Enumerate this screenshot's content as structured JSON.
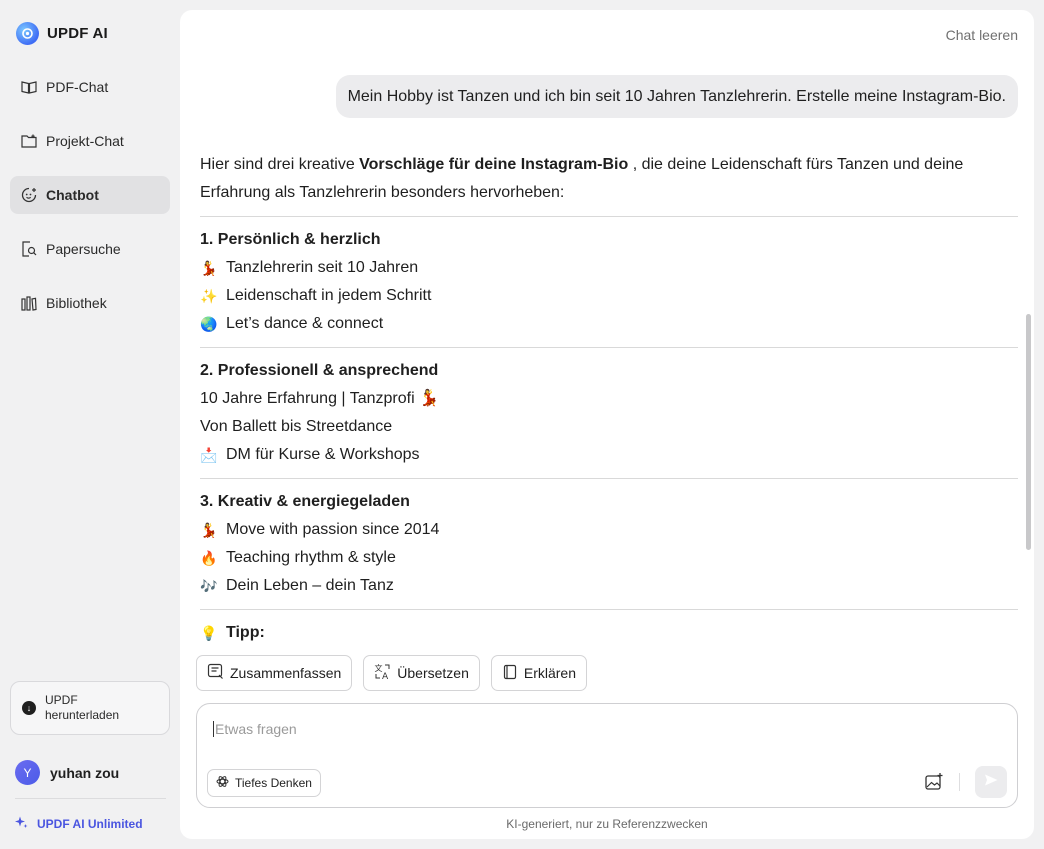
{
  "app": {
    "title": "UPDF AI"
  },
  "sidebar": {
    "items": [
      {
        "label": "PDF-Chat",
        "icon": "book-open-icon",
        "active": false
      },
      {
        "label": "Projekt-Chat",
        "icon": "folder-plus-icon",
        "active": false
      },
      {
        "label": "Chatbot",
        "icon": "chatbot-icon",
        "active": true
      },
      {
        "label": "Papersuche",
        "icon": "paper-search-icon",
        "active": false
      },
      {
        "label": "Bibliothek",
        "icon": "library-icon",
        "active": false
      }
    ],
    "download_label": "UPDF herunterladen",
    "user": {
      "initial": "Y",
      "name": "yuhan zou"
    },
    "unlimited_label": "UPDF AI Unlimited"
  },
  "chat": {
    "clear_label": "Chat leeren",
    "user_message": "Mein Hobby ist Tanzen und ich bin seit 10 Jahren Tanzlehrerin. Erstelle meine Instagram-Bio.",
    "answer": {
      "intro_prefix": "Hier sind drei kreative ",
      "intro_bold": "Vorschläge für deine Instagram-Bio",
      "intro_suffix": " , die deine Leidenschaft fürs Tanzen und deine Erfahrung als Tanzlehrerin besonders hervorheben:",
      "sections": [
        {
          "title": "1. Persönlich & herzlich",
          "lines": [
            {
              "emoji": "💃",
              "text": "Tanzlehrerin seit 10 Jahren"
            },
            {
              "emoji": "✨",
              "text": "Leidenschaft in jedem Schritt"
            },
            {
              "emoji": "🌏",
              "text": "Let’s dance & connect"
            }
          ]
        },
        {
          "title": "2. Professionell & ansprechend",
          "lines": [
            {
              "emoji": "",
              "text": "10 Jahre Erfahrung | Tanzprofi 💃"
            },
            {
              "emoji": "",
              "text": "Von Ballett bis Streetdance"
            },
            {
              "emoji": "📩",
              "text": "DM für Kurse & Workshops"
            }
          ]
        },
        {
          "title": "3. Kreativ & energiegeladen",
          "lines": [
            {
              "emoji": "💃",
              "text": "Move with passion since 2014"
            },
            {
              "emoji": "🔥",
              "text": "Teaching rhythm & style"
            },
            {
              "emoji": "🎶",
              "text": "Dein Leben – dein Tanz"
            }
          ]
        }
      ],
      "tip_emoji": "💡",
      "tip_label": "Tipp:"
    },
    "actions": [
      {
        "label": "Zusammenfassen",
        "icon": "summarize-icon"
      },
      {
        "label": "Übersetzen",
        "icon": "translate-icon"
      },
      {
        "label": "Erklären",
        "icon": "explain-book-icon"
      }
    ],
    "composer": {
      "placeholder": "Etwas fragen",
      "deep_think_label": "Tiefes Denken"
    },
    "disclaimer": "KI-generiert, nur zu Referenzzwecken"
  }
}
